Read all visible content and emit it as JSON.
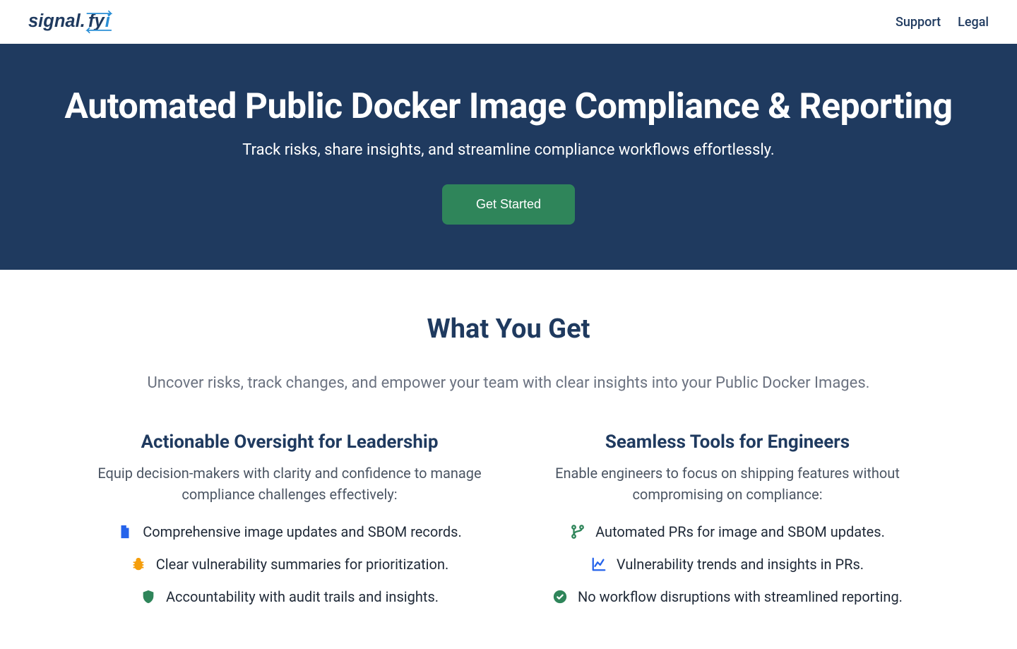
{
  "nav": {
    "support": "Support",
    "legal": "Legal"
  },
  "hero": {
    "title": "Automated Public Docker Image Compliance & Reporting",
    "subtitle": "Track risks, share insights, and streamline compliance workflows effortlessly.",
    "cta": "Get Started"
  },
  "section": {
    "title": "What You Get",
    "subtitle": "Uncover risks, track changes, and empower your team with clear insights into your Public Docker Images."
  },
  "leadership": {
    "title": "Actionable Oversight for Leadership",
    "desc": "Equip decision-makers with clarity and confidence to manage compliance challenges effectively:",
    "items": [
      "Comprehensive image updates and SBOM records.",
      "Clear vulnerability summaries for prioritization.",
      "Accountability with audit trails and insights."
    ]
  },
  "engineers": {
    "title": "Seamless Tools for Engineers",
    "desc": "Enable engineers to focus on shipping features without compromising on compliance:",
    "items": [
      "Automated PRs for image and SBOM updates.",
      "Vulnerability trends and insights in PRs.",
      "No workflow disruptions with streamlined reporting."
    ]
  }
}
